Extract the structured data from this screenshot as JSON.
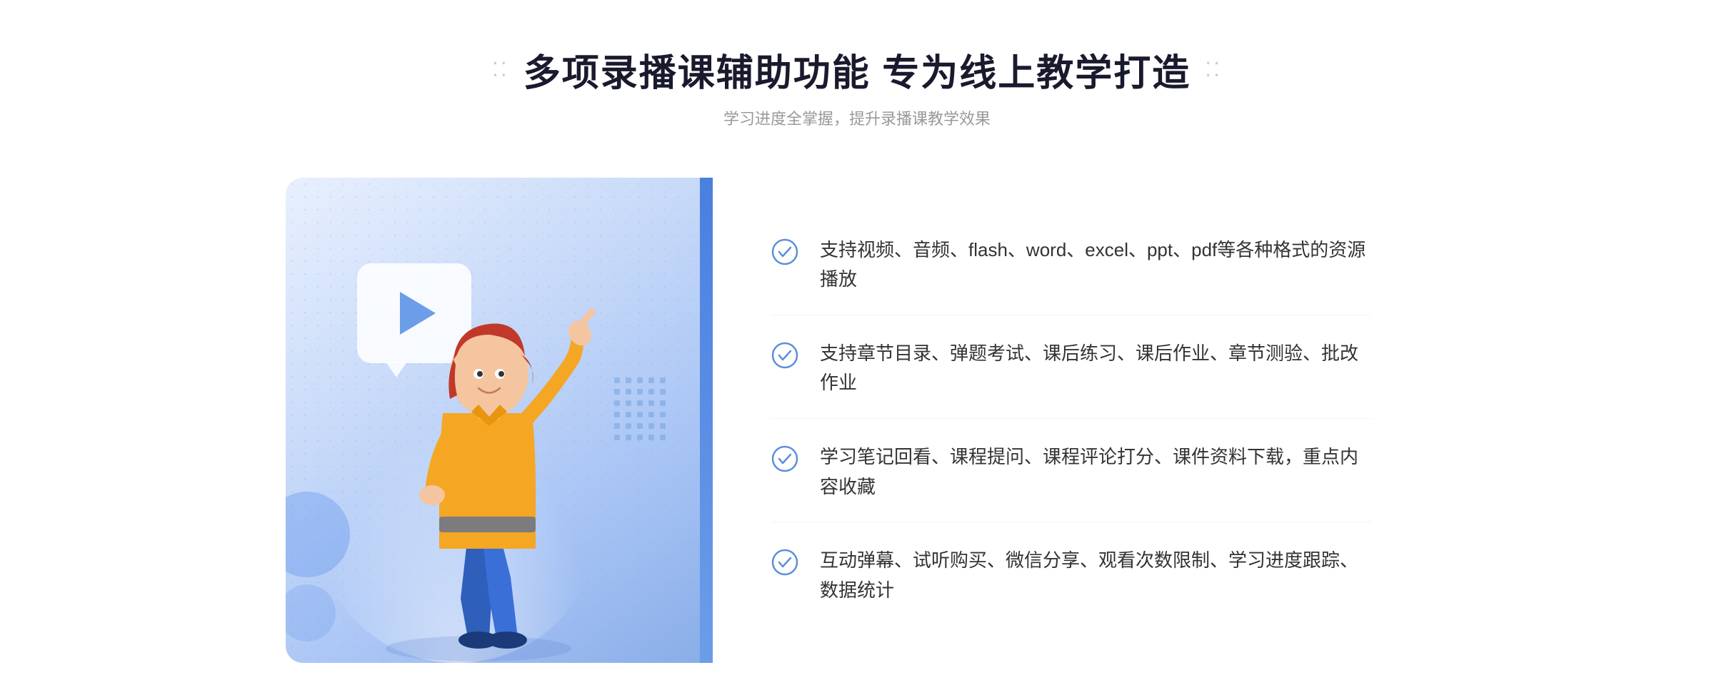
{
  "header": {
    "title": "多项录播课辅助功能 专为线上教学打造",
    "subtitle": "学习进度全掌握，提升录播课教学效果",
    "title_dots_left": "⁞⁞",
    "title_dots_right": "⁞⁞"
  },
  "features": [
    {
      "id": 1,
      "text": "支持视频、音频、flash、word、excel、ppt、pdf等各种格式的资源播放"
    },
    {
      "id": 2,
      "text": "支持章节目录、弹题考试、课后练习、课后作业、章节测验、批改作业"
    },
    {
      "id": 3,
      "text": "学习笔记回看、课程提问、课程评论打分、课件资料下载，重点内容收藏"
    },
    {
      "id": 4,
      "text": "互动弹幕、试听购买、微信分享、观看次数限制、学习进度跟踪、数据统计"
    }
  ],
  "colors": {
    "accent": "#4a7fe0",
    "title": "#1a1a2e",
    "subtitle": "#999999",
    "feature_text": "#333333",
    "check_color": "#5b8fdd",
    "gradient_start": "#e8f0fe",
    "gradient_end": "#8aaee8"
  }
}
